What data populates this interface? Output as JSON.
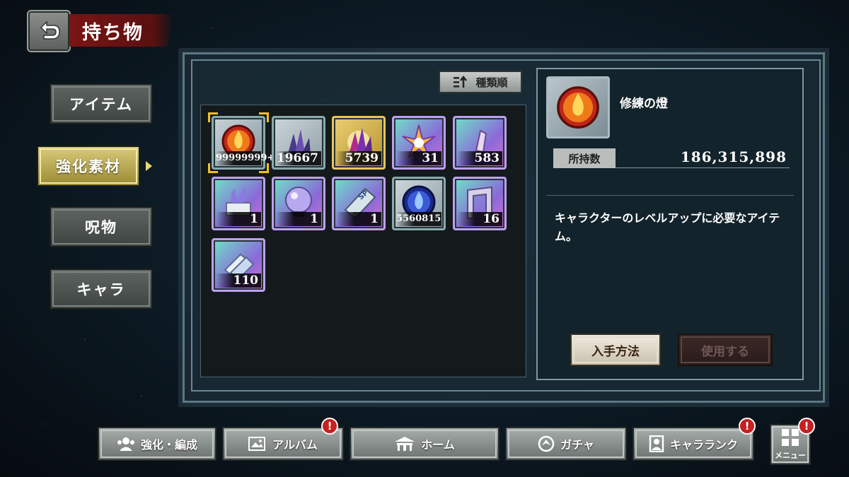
{
  "header": {
    "title": "持ち物"
  },
  "tabs": [
    {
      "label": "アイテム",
      "active": false
    },
    {
      "label": "強化素材",
      "active": true
    },
    {
      "label": "呪物",
      "active": false
    },
    {
      "label": "キャラ",
      "active": false
    }
  ],
  "sort": {
    "label": "種類順"
  },
  "items": [
    {
      "name": "修練の燈",
      "count": "99999999+",
      "icon": "flame-orb-icon",
      "selected": true
    },
    {
      "count": "19667",
      "icon": "crystal-cluster-icon"
    },
    {
      "count": "5739",
      "icon": "crystal-cluster-gold-icon"
    },
    {
      "count": "31",
      "icon": "crystal-burst-icon"
    },
    {
      "count": "583",
      "icon": "crystal-shard-icon"
    },
    {
      "count": "1",
      "icon": "altar-icon"
    },
    {
      "count": "1",
      "icon": "crystal-ball-icon"
    },
    {
      "count": "1",
      "icon": "sp-book-icon"
    },
    {
      "count": "5560815",
      "icon": "blue-flame-orb-icon"
    },
    {
      "count": "16",
      "icon": "stone-gate-icon"
    },
    {
      "count": "110",
      "icon": "ticket-stack-icon"
    }
  ],
  "detail": {
    "name": "修練の燈",
    "owned_label": "所持数",
    "owned_value": "186,315,898",
    "description": "キャラクターのレベルアップに必要なアイテム。",
    "acquire_label": "入手方法",
    "use_label": "使用する"
  },
  "nav": {
    "enhance": "強化・編成",
    "album": "アルバム",
    "home": "ホーム",
    "gacha": "ガチャ",
    "rank": "キャラランク",
    "menu": "メニュー",
    "badge": "!"
  }
}
